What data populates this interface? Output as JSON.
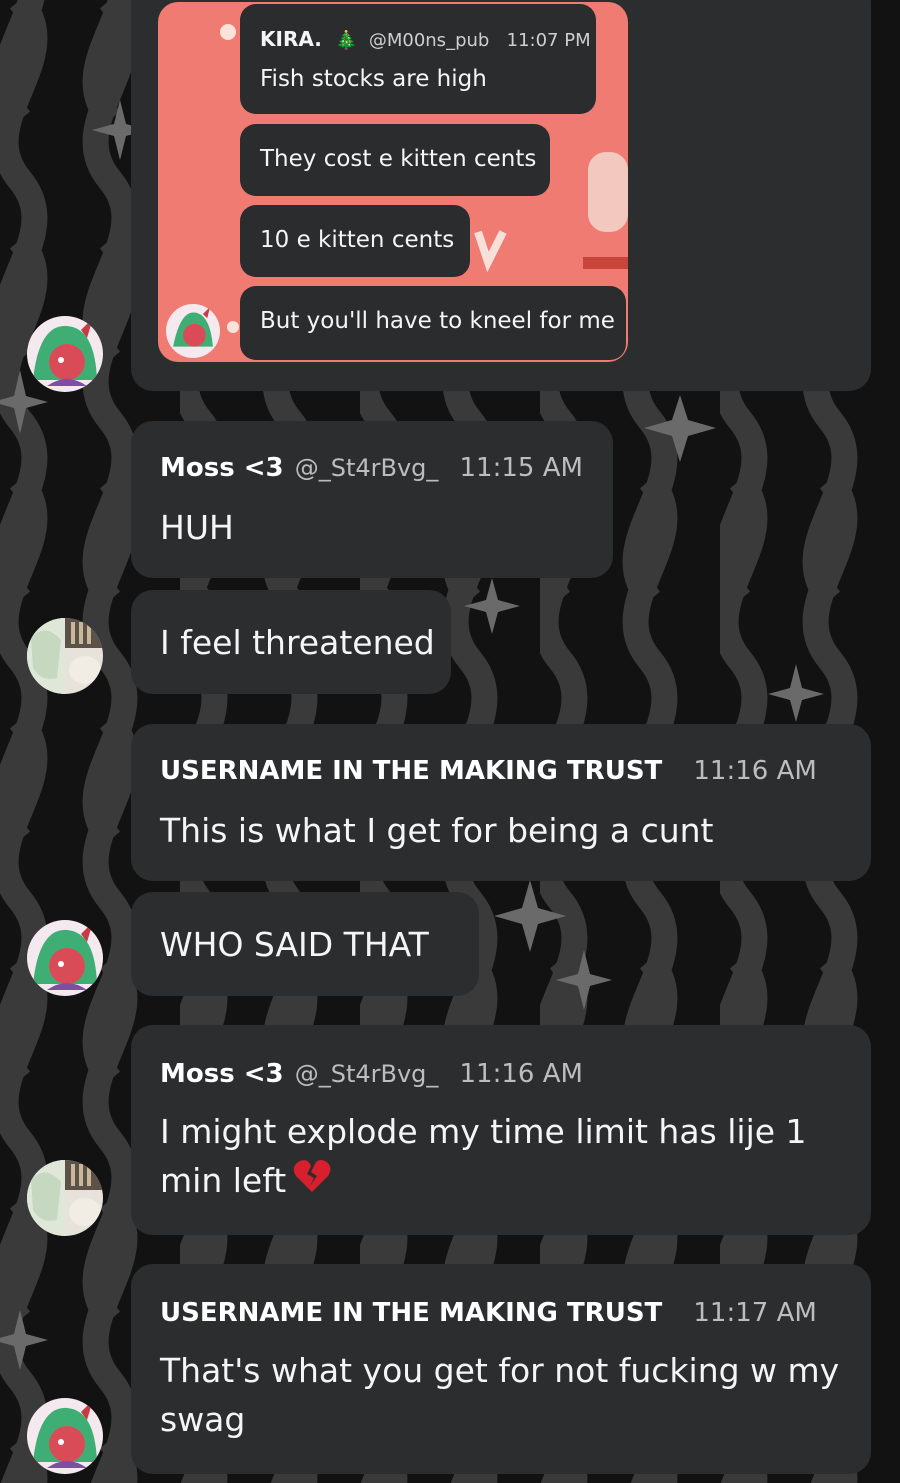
{
  "screenshot": {
    "header": {
      "name": "KIRA.",
      "emoji": "🎄",
      "handle": "@M00ns_pub",
      "time": "11:07 PM"
    },
    "messages": [
      "Fish stocks are high",
      "They cost e kitten cents",
      "10 e kitten cents",
      "But you'll have to kneel for me"
    ]
  },
  "chat": [
    {
      "user": "Moss <3",
      "handle": "@_St4rBvg_",
      "time": "11:15 AM",
      "text": "HUH"
    },
    {
      "text": "I feel threatened"
    },
    {
      "user": "USERNAME IN THE MAKING TRUST",
      "time": "11:16 AM",
      "text": "This is what I get for being a cunt"
    },
    {
      "text": "WHO SAID THAT"
    },
    {
      "user": "Moss <3",
      "handle": "@_St4rBvg_",
      "time": "11:16 AM",
      "text_line1": "I might explode my time limit has lije 1",
      "text_line2": "min left",
      "emoji": "💔"
    },
    {
      "user": "USERNAME IN THE MAKING TRUST",
      "time": "11:17 AM",
      "text_line1": "That's what you get for not fucking w my",
      "text_line2": "swag"
    }
  ],
  "colors": {
    "background": "#121212",
    "bubble": "#2b2d2f",
    "screenshot_bg": "#ef7b72"
  }
}
